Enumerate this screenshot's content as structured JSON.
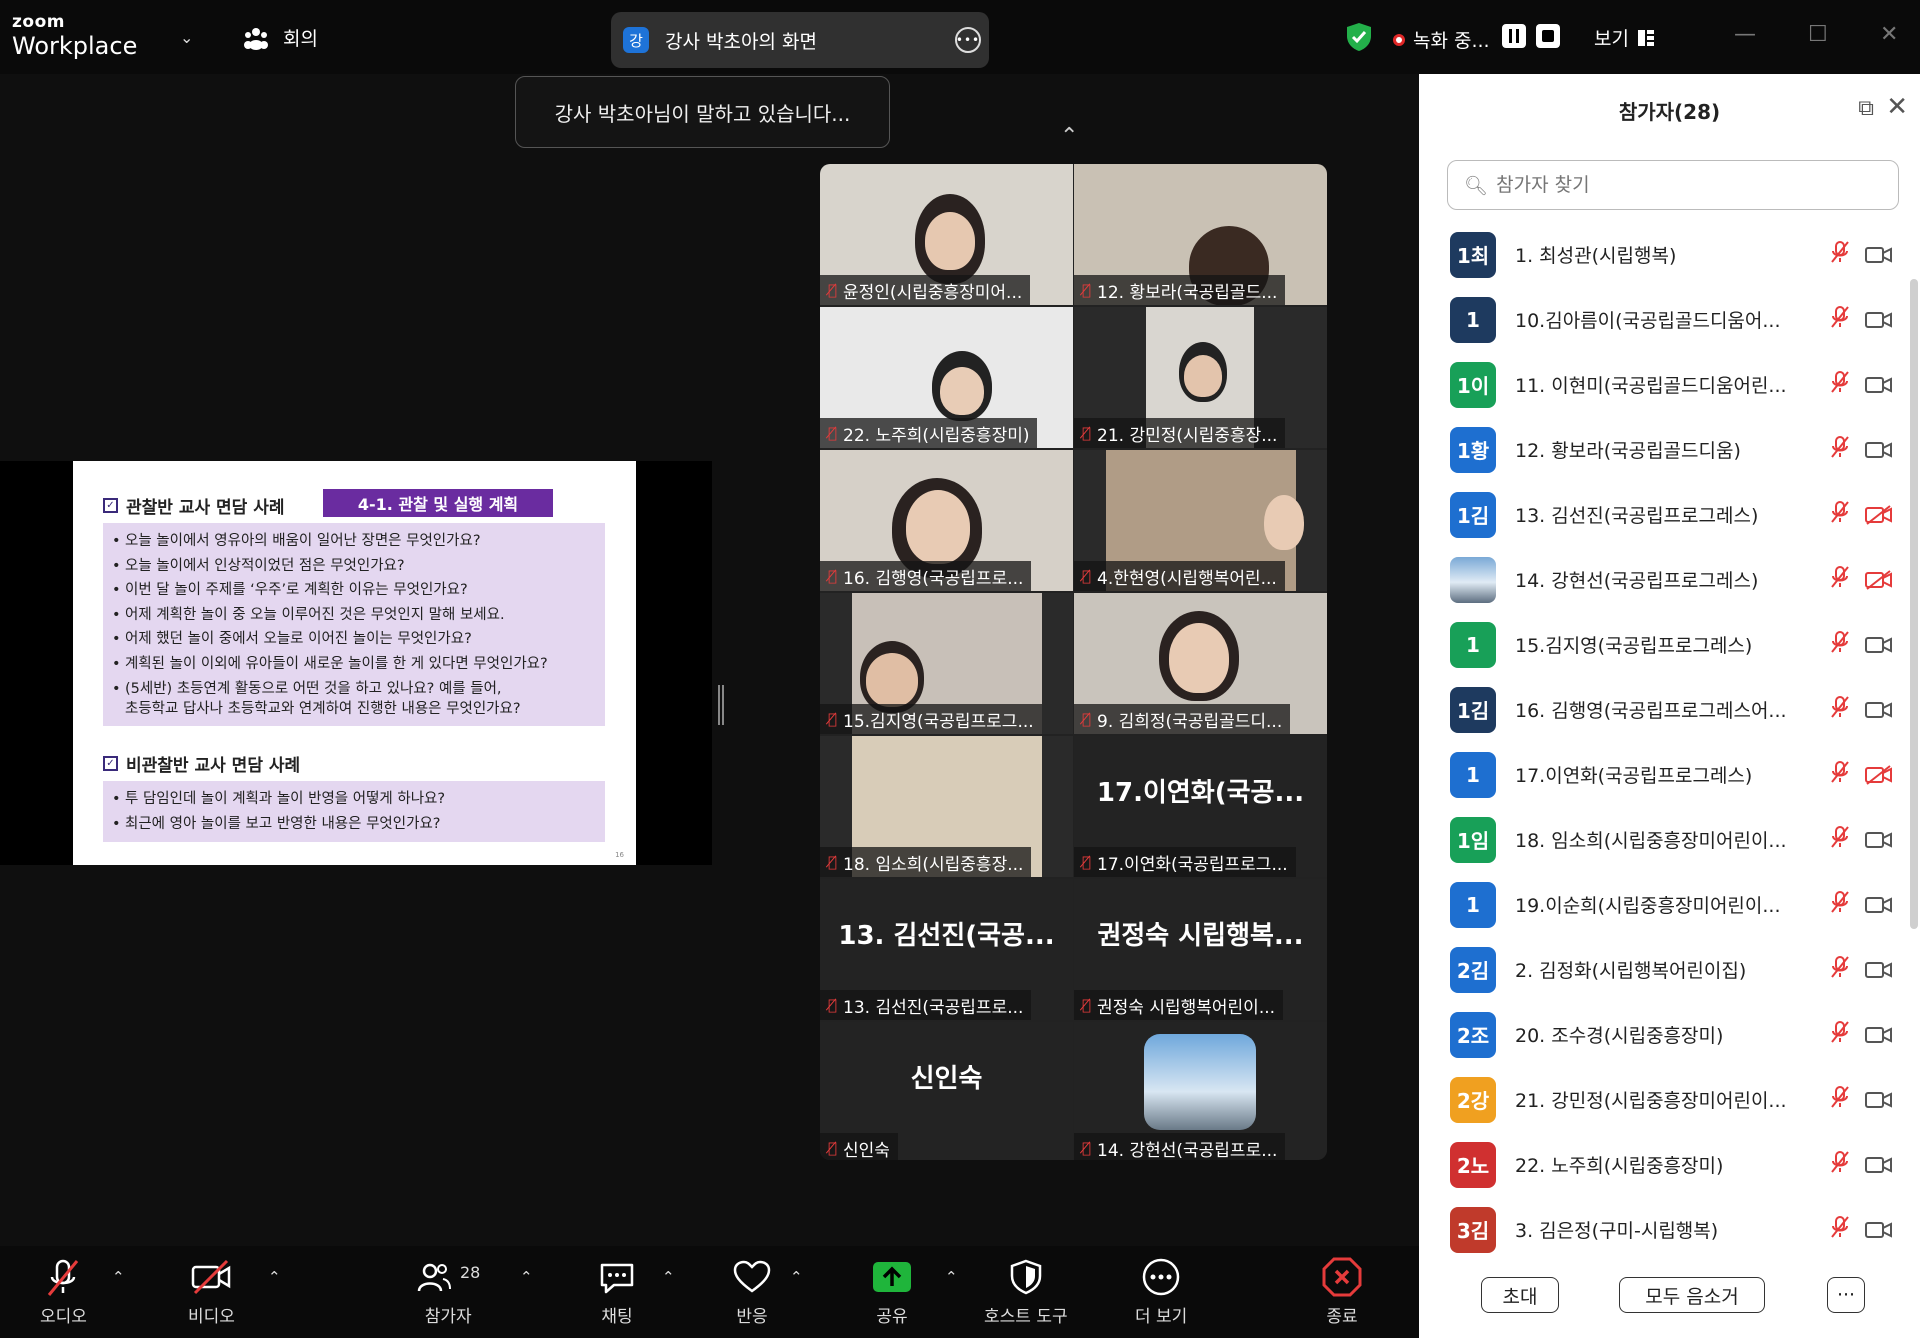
{
  "topbar": {
    "logo_zoom": "zoom",
    "logo_workplace": "Workplace",
    "meeting_label": "회의",
    "share_badge": "강",
    "share_title": "강사 박초아의 화면",
    "recording_label": "녹화 중...",
    "view_label": "보기"
  },
  "speaking_toast": "강사 박초아님이 말하고 있습니다...",
  "slide": {
    "section1_title": "관찰반 교사 면담 사례",
    "tag": "4-1. 관찰 및 실행 계획",
    "section1_items": [
      "오늘 놀이에서 영유아의 배움이 일어난 장면은 무엇인가요?",
      "오늘 놀이에서 인상적이었던 점은 무엇인가요?",
      "이번 달 놀이 주제를 ‘우주’로 계획한 이유는 무엇인가요?",
      "어제 계획한 놀이 중 오늘 이루어진 것은 무엇인지 말해 보세요.",
      "어제 했던 놀이 중에서 오늘로 이어진 놀이는 무엇인가요?",
      "계획된 놀이 이외에 유아들이 새로운 놀이를 한 게 있다면 무엇인가요?",
      "(5세반) 초등연계 활동으로 어떤 것을 하고 있나요? 예를 들어,"
    ],
    "section1_item7_line2": "초등학교 답사나 초등학교와 연계하여 진행한 내용은 무엇인가요?",
    "section2_title": "비관찰반 교사 면담 사례",
    "section2_items": [
      "투 담임인데 놀이 계획과 놀이 반영을 어떻게 하나요?",
      "최근에 영아 놀이를 보고 반영한 내용은 무엇인가요?"
    ],
    "page_number": "16"
  },
  "gallery": [
    {
      "name": "윤정인(시립중흥장미어...",
      "big": ""
    },
    {
      "name": "12. 황보라(국공립골드...",
      "big": ""
    },
    {
      "name": "22. 노주희(시립중흥장미)",
      "big": ""
    },
    {
      "name": "21. 강민정(시립중흥장...",
      "big": ""
    },
    {
      "name": "16. 김행영(국공립프로...",
      "big": ""
    },
    {
      "name": "4.한현영(시립행복어린...",
      "big": ""
    },
    {
      "name": "15.김지영(국공립프로그...",
      "big": ""
    },
    {
      "name": "9. 김희정(국공립골드디...",
      "big": ""
    },
    {
      "name": "18. 임소희(시립중흥장...",
      "big": ""
    },
    {
      "name": "17.이연화(국공립프로그...",
      "big": "17.이연화(국공..."
    },
    {
      "name": "13. 김선진(국공립프로...",
      "big": "13. 김선진(국공..."
    },
    {
      "name": "권정숙 시립행복어린이...",
      "big": "권정숙 시립행복..."
    },
    {
      "name": "신인숙",
      "big": "신인숙"
    },
    {
      "name": "14. 강현선(국공립프로...",
      "big": ""
    }
  ],
  "participants": {
    "title": "참가자(28)",
    "search_placeholder": "참가자 찾기",
    "list": [
      {
        "avatar": "1최",
        "name": "1. 최성관(시립행복)",
        "color": "#1e3a5f",
        "video_off": false
      },
      {
        "avatar": "1",
        "name": "10.김아름이(국공립골드디움어...",
        "color": "#1e3a5f",
        "video_off": false
      },
      {
        "avatar": "1이",
        "name": "11. 이현미(국공립골드디움어린...",
        "color": "#18a058",
        "video_off": false
      },
      {
        "avatar": "1황",
        "name": "12. 황보라(국공립골드디움)",
        "color": "#1e6fd0",
        "video_off": false
      },
      {
        "avatar": "1김",
        "name": "13. 김선진(국공립프로그레스)",
        "color": "#1e6fd0",
        "video_off": true
      },
      {
        "avatar": "",
        "name": "14. 강현선(국공립프로그레스)",
        "color": "#6b8fb0",
        "video_off": true
      },
      {
        "avatar": "1",
        "name": "15.김지영(국공립프로그레스)",
        "color": "#18a058",
        "video_off": false
      },
      {
        "avatar": "1김",
        "name": "16. 김행영(국공립프로그레스어...",
        "color": "#1e3a5f",
        "video_off": false
      },
      {
        "avatar": "1",
        "name": "17.이연화(국공립프로그레스)",
        "color": "#1e6fd0",
        "video_off": true
      },
      {
        "avatar": "1임",
        "name": "18. 임소희(시립중흥장미어린이...",
        "color": "#18a058",
        "video_off": false
      },
      {
        "avatar": "1",
        "name": "19.이순희(시립중흥장미어린이...",
        "color": "#1e6fd0",
        "video_off": false
      },
      {
        "avatar": "2김",
        "name": "2. 김정화(시립행복어린이집)",
        "color": "#1e6fd0",
        "video_off": false
      },
      {
        "avatar": "2조",
        "name": "20. 조수경(시립중흥장미)",
        "color": "#1e6fd0",
        "video_off": false
      },
      {
        "avatar": "2강",
        "name": "21. 강민정(시립중흥장미어린이...",
        "color": "#f0a020",
        "video_off": false
      },
      {
        "avatar": "2노",
        "name": "22. 노주희(시립중흥장미)",
        "color": "#d03030",
        "video_off": false
      },
      {
        "avatar": "3김",
        "name": "3. 김은정(구미-시립행복)",
        "color": "#c03a2b",
        "video_off": false
      }
    ],
    "invite_label": "초대",
    "mute_all_label": "모두 음소거",
    "more_label": "···"
  },
  "toolbar": {
    "audio_label": "오디오",
    "video_label": "비디오",
    "participants_label": "참가자",
    "participants_count": "28",
    "chat_label": "채팅",
    "react_label": "반응",
    "share_label": "공유",
    "host_tools_label": "호스트 도구",
    "more_label": "더 보기",
    "end_label": "종료"
  }
}
